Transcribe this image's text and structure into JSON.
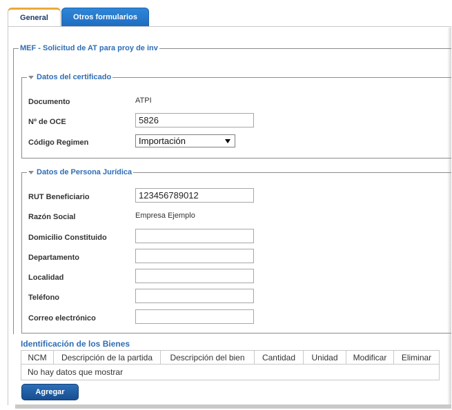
{
  "tabs": [
    {
      "label": "General"
    },
    {
      "label": "Otros formularios"
    }
  ],
  "form": {
    "title": "MEF - Solicitud de AT para proy de inv",
    "certificado": {
      "legend": "Datos del certificado",
      "documento_label": "Documento",
      "documento_value": "ATPI",
      "oce_label": "Nº de OCE",
      "oce_value": "5826",
      "regimen_label": "Código Regimen",
      "regimen_value": "Importación"
    },
    "persona": {
      "legend": "Datos de Persona Jurídica",
      "rut_label": "RUT Beneficiario",
      "rut_value": "123456789012",
      "razon_label": "Razón Social",
      "razon_value": "Empresa Ejemplo",
      "domicilio_label": "Domicilio Constituido",
      "domicilio_value": "",
      "departamento_label": "Departamento",
      "departamento_value": "",
      "localidad_label": "Localidad",
      "localidad_value": "",
      "telefono_label": "Teléfono",
      "telefono_value": "",
      "correo_label": "Correo electrónico",
      "correo_value": ""
    }
  },
  "bienes": {
    "title": "Identificación de los Bienes",
    "columns": [
      "NCM",
      "Descripción de la partida",
      "Descripción del bien",
      "Cantidad",
      "Unidad",
      "Modificar",
      "Eliminar"
    ],
    "empty_text": "No hay datos que mostrar",
    "add_label": "Agregar"
  }
}
